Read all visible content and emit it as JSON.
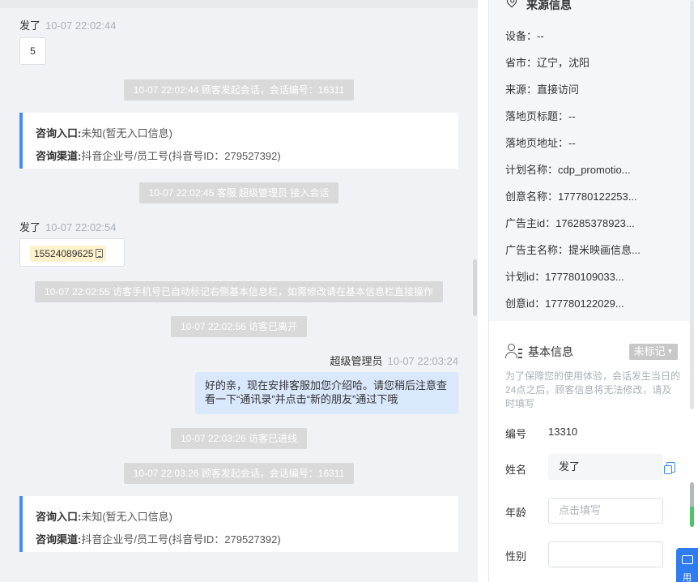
{
  "chat": {
    "m1": {
      "sender": "发了",
      "time": "10-07 22:02:44",
      "content": "5"
    },
    "sys1": "10-07 22:02:44 顾客发起会话，会话编号：16311",
    "card1": {
      "entry_label": "咨询入口:",
      "entry_value": "未知(暂无入口信息)",
      "channel_label": "咨询渠道:",
      "channel_value": "抖音企业号/员工号(抖音号ID：279527392)"
    },
    "sys2": "10-07 22:02:45 客服 超级管理员 接入会话",
    "m2": {
      "sender": "发了",
      "time": "10-07 22:02:54",
      "phone": "15524089625"
    },
    "sys3": "10-07 22:02:55 访客手机号已自动标记右侧基本信息栏，如需修改请在基本信息栏直接操作",
    "sys4": "10-07 22:02:56 访客已离开",
    "m3": {
      "sender": "超级管理员",
      "time": "10-07 22:03:24",
      "content": "好的亲，现在安排客服加您介绍哈。请您稍后注意查看一下“通讯录”并点击“新的朋友”通过下哦"
    },
    "sys5": "10-07 22:03:26 访客已进线",
    "sys6": "10-07 22:03:26 顾客发起会话，会话编号：16311",
    "card2": {
      "entry_label": "咨询入口:",
      "entry_value": "未知(暂无入口信息)",
      "channel_label": "咨询渠道:",
      "channel_value": "抖音企业号/员工号(抖音号ID：279527392)"
    }
  },
  "source": {
    "title": "来源信息",
    "rows": [
      "设备：--",
      "省市：辽宁，沈阳",
      "来源：直接访问",
      "落地页标题：--",
      "落地页地址：--",
      "计划名称：cdp_promotio...",
      "创意名称：177780122253...",
      "广告主id：176285378923...",
      "广告主名称：提米映画信息...",
      "计划id：177780109033...",
      "创意id：177780122029..."
    ]
  },
  "basic": {
    "title": "基本信息",
    "status": "未标记",
    "note": "为了保障您的使用体验，会话发生当日的24点之后，顾客信息将无法修改，请及时填写",
    "id_label": "编号",
    "id_value": "13310",
    "name_label": "姓名",
    "name_value": "发了",
    "age_label": "年龄",
    "age_placeholder": "点击填写",
    "gender_label": "性别"
  },
  "float_button": {
    "label": "用"
  }
}
